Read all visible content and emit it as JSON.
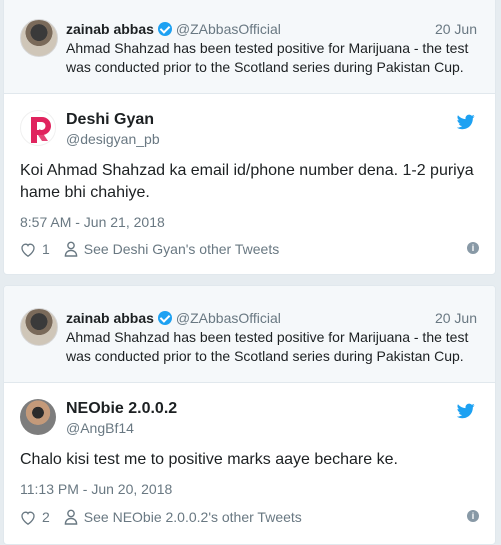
{
  "tweets": [
    {
      "quoted": {
        "name": "zainab abbas",
        "handle": "@ZAbbasOfficial",
        "date": "20 Jun",
        "text": "Ahmad Shahzad has been tested positive for Marijuana - the test was conducted prior to the Scotland series during Pakistan Cup."
      },
      "name": "Deshi Gyan",
      "handle": "@desigyan_pb",
      "text": "Koi Ahmad Shahzad ka email id/phone number dena. 1-2 puriya hame bhi chahiye.",
      "timestamp": "8:57 AM - Jun 21, 2018",
      "likes": "1",
      "other_tweets": "See Deshi Gyan's other Tweets"
    },
    {
      "quoted": {
        "name": "zainab abbas",
        "handle": "@ZAbbasOfficial",
        "date": "20 Jun",
        "text": "Ahmad Shahzad has been tested positive for Marijuana - the test was conducted prior to the Scotland series during Pakistan Cup."
      },
      "name": "NEObie 2.0.0.2",
      "handle": "@AngBf14",
      "text": "Chalo kisi test me to positive marks aaye bechare ke.",
      "timestamp": "11:13 PM - Jun 20, 2018",
      "likes": "2",
      "other_tweets": "See NEObie 2.0.0.2's other Tweets"
    }
  ],
  "colors": {
    "accent": "#1da1f2",
    "brand_red": "#e0245e",
    "muted": "#697882",
    "background": "#e6ecf0"
  },
  "icons": [
    "verified-badge-icon",
    "twitter-bird-icon",
    "heart-icon",
    "person-icon",
    "info-icon"
  ]
}
